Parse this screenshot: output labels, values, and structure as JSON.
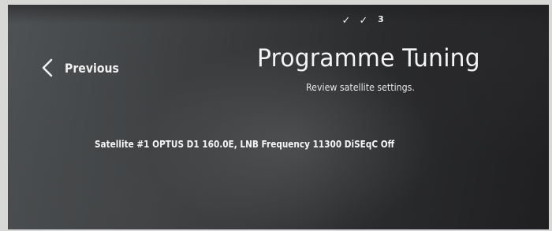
{
  "progress": {
    "steps": [
      "✓",
      "✓",
      "3"
    ]
  },
  "nav": {
    "previous_label": "Previous"
  },
  "header": {
    "title": "Programme Tuning",
    "subtitle": "Review satellite settings."
  },
  "main": {
    "satellite_info": "Satellite #1 OPTUS D1 160.0E, LNB Frequency 11300 DiSEqC Off"
  },
  "icons": {
    "previous": "chevron-left-icon",
    "step_done": "checkmark-icon"
  }
}
